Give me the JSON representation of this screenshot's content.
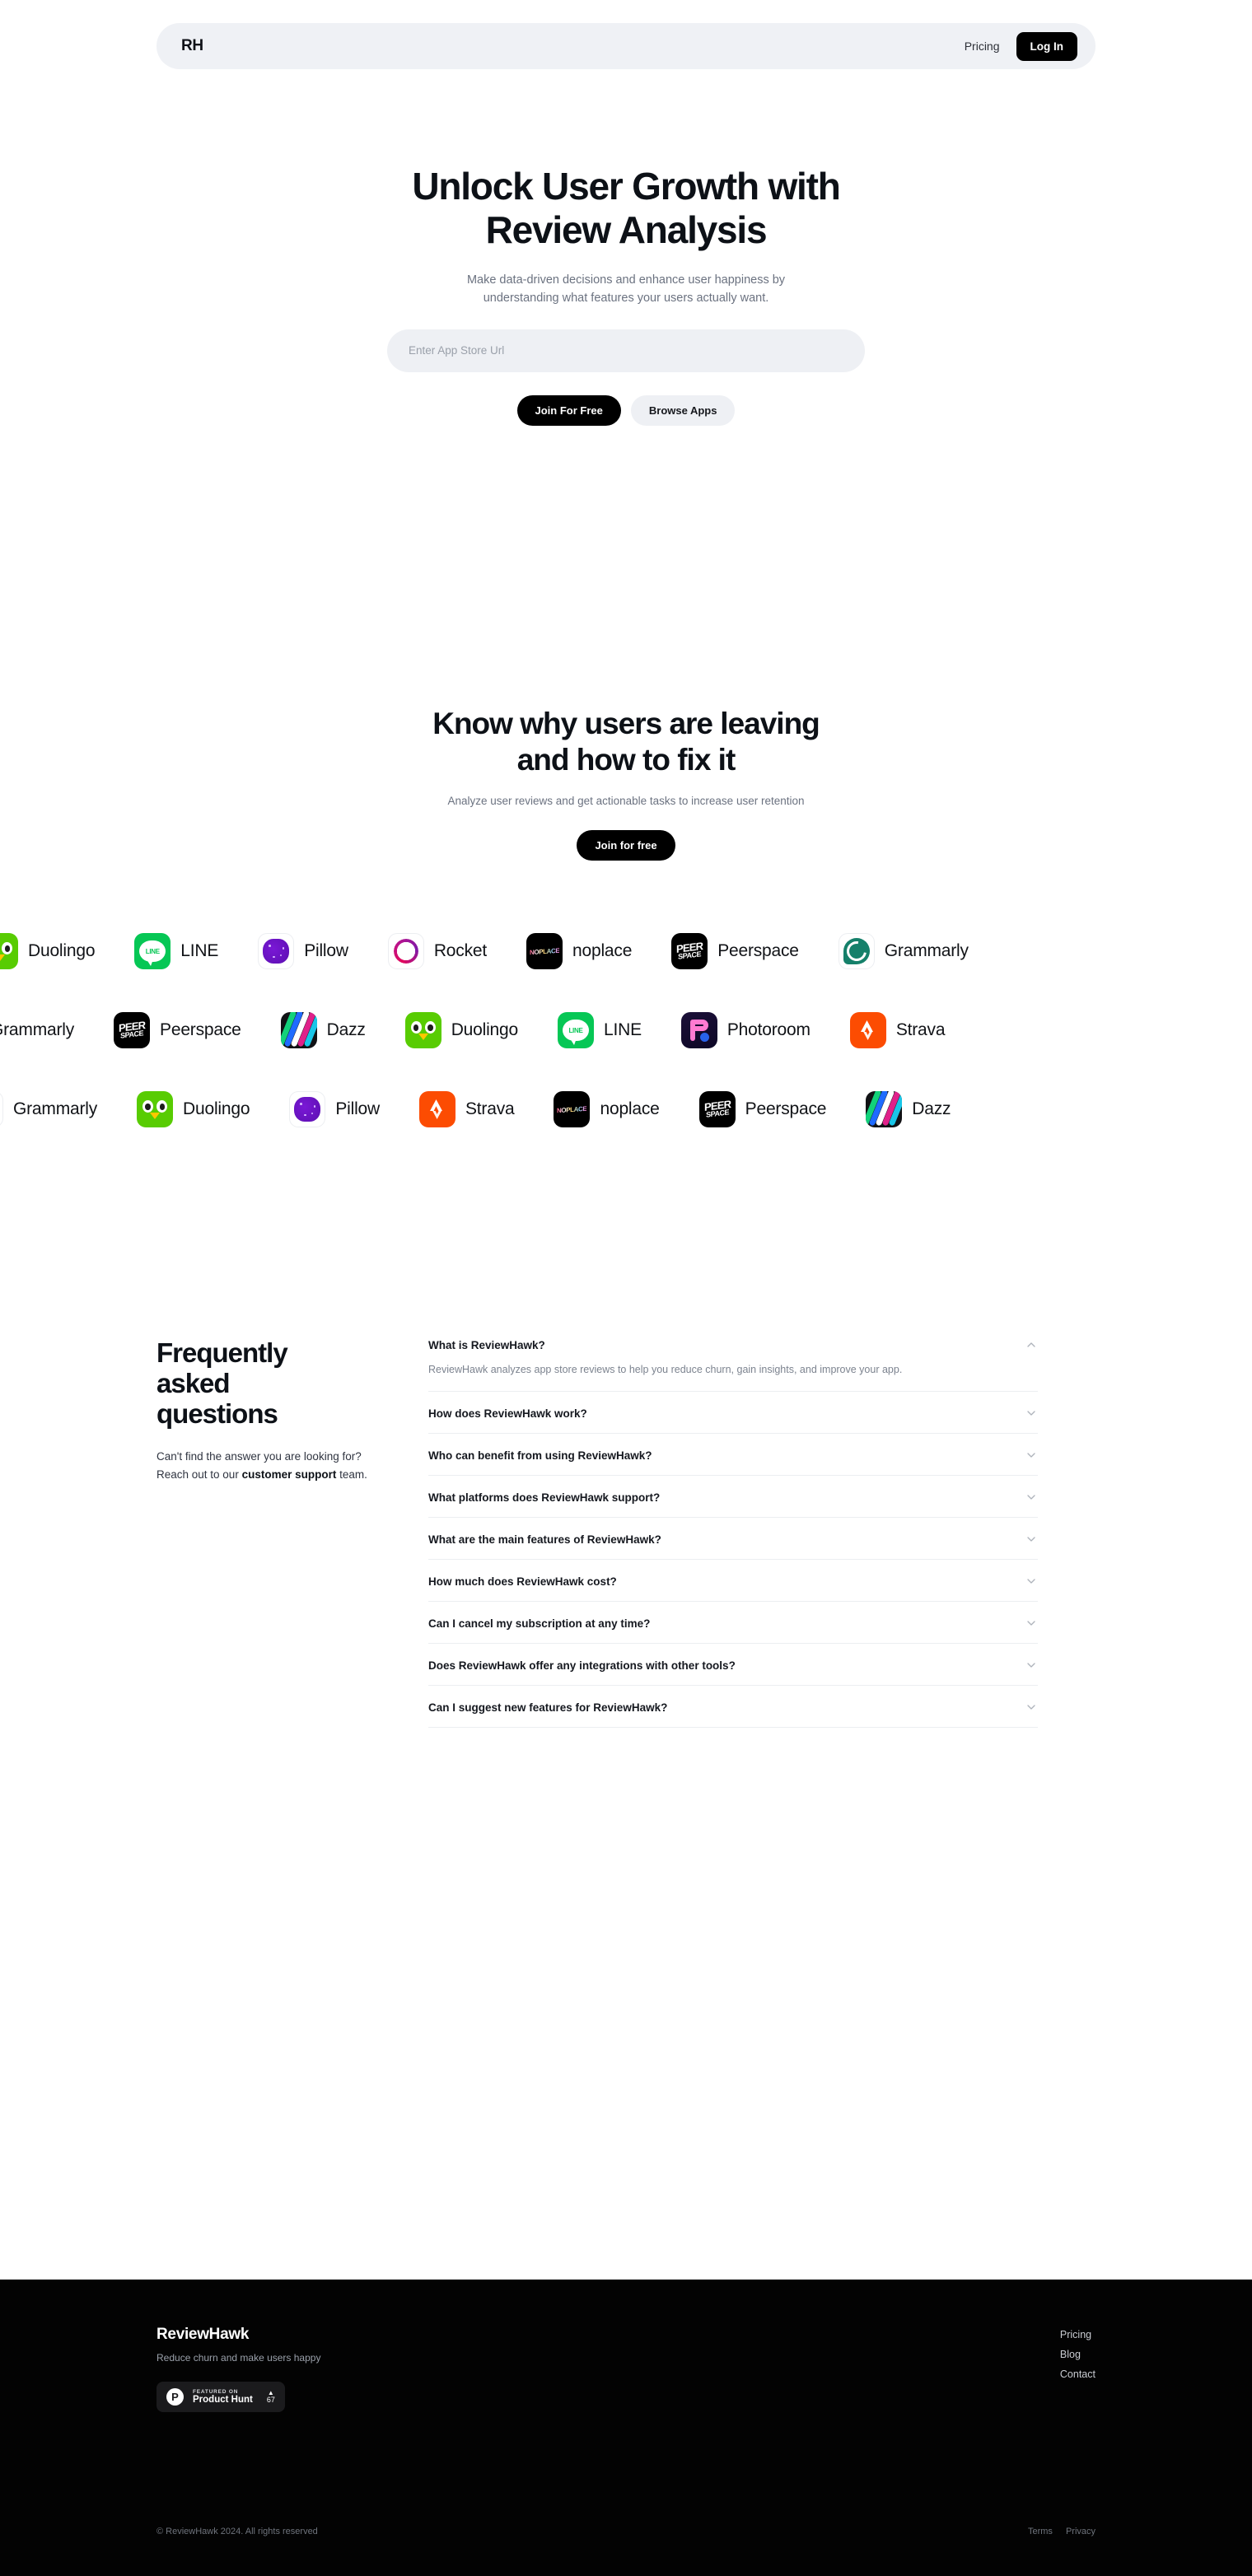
{
  "nav": {
    "logo": "RH",
    "pricing_label": "Pricing",
    "login_label": "Log In"
  },
  "hero": {
    "title_line1": "Unlock User Growth with",
    "title_line2": "Review Analysis",
    "subtitle_line1": "Make data-driven decisions and enhance user happiness by",
    "subtitle_line2": "understanding what features your users actually want.",
    "input_placeholder": "Enter App Store Url",
    "input_value": "",
    "primary_cta": "Join For Free",
    "secondary_cta": "Browse Apps"
  },
  "section2": {
    "title_line1": "Know why users are leaving",
    "title_line2": "and how to fix it",
    "subtitle": "Analyze user reviews and get actionable tasks to increase user retention",
    "cta": "Join for free"
  },
  "marquee": {
    "row1": [
      {
        "name": "Duolingo",
        "icon": "duolingo-icon"
      },
      {
        "name": "LINE",
        "icon": "line-icon"
      },
      {
        "name": "Pillow",
        "icon": "pillow-icon"
      },
      {
        "name": "Rocket",
        "icon": "rocket-icon"
      },
      {
        "name": "noplace",
        "icon": "noplace-icon"
      },
      {
        "name": "Peerspace",
        "icon": "peerspace-icon"
      },
      {
        "name": "Grammarly",
        "icon": "grammarly-icon"
      }
    ],
    "row2": [
      {
        "name": "Grammarly",
        "icon": "grammarly-icon"
      },
      {
        "name": "Peerspace",
        "icon": "peerspace-icon"
      },
      {
        "name": "Dazz",
        "icon": "dazz-icon"
      },
      {
        "name": "Duolingo",
        "icon": "duolingo-icon"
      },
      {
        "name": "LINE",
        "icon": "line-icon"
      },
      {
        "name": "Photoroom",
        "icon": "photoroom-icon"
      },
      {
        "name": "Strava",
        "icon": "strava-icon"
      }
    ],
    "row3": [
      {
        "name": "Grammarly",
        "icon": "grammarly-icon"
      },
      {
        "name": "Duolingo",
        "icon": "duolingo-icon"
      },
      {
        "name": "Pillow",
        "icon": "pillow-icon"
      },
      {
        "name": "Strava",
        "icon": "strava-icon"
      },
      {
        "name": "noplace",
        "icon": "noplace-icon"
      },
      {
        "name": "Peerspace",
        "icon": "peerspace-icon"
      },
      {
        "name": "Dazz",
        "icon": "dazz-icon"
      }
    ]
  },
  "faq": {
    "title_line1": "Frequently",
    "title_line2": "asked",
    "title_line3": "questions",
    "help_text_before": "Can't find the answer you are looking for? Reach out to our ",
    "help_text_bold": "customer support",
    "help_text_after": " team.",
    "items": [
      {
        "question": "What is ReviewHawk?",
        "answer": "ReviewHawk analyzes app store reviews to help you reduce churn, gain insights, and improve your app.",
        "expanded": true
      },
      {
        "question": "How does ReviewHawk work?",
        "answer": "",
        "expanded": false
      },
      {
        "question": "Who can benefit from using ReviewHawk?",
        "answer": "",
        "expanded": false
      },
      {
        "question": "What platforms does ReviewHawk support?",
        "answer": "",
        "expanded": false
      },
      {
        "question": "What are the main features of ReviewHawk?",
        "answer": "",
        "expanded": false
      },
      {
        "question": "How much does ReviewHawk cost?",
        "answer": "",
        "expanded": false
      },
      {
        "question": "Can I cancel my subscription at any time?",
        "answer": "",
        "expanded": false
      },
      {
        "question": "Does ReviewHawk offer any integrations with other tools?",
        "answer": "",
        "expanded": false
      },
      {
        "question": "Can I suggest new features for ReviewHawk?",
        "answer": "",
        "expanded": false
      }
    ]
  },
  "footer": {
    "brand": "ReviewHawk",
    "tagline": "Reduce churn and make users happy",
    "product_hunt": {
      "featured_label": "FEATURED ON",
      "name": "Product Hunt",
      "upvotes": "67"
    },
    "links": [
      "Pricing",
      "Blog",
      "Contact"
    ],
    "copyright": "© ReviewHawk 2024. All rights reserved",
    "legal": [
      "Terms",
      "Privacy"
    ]
  },
  "colors": {
    "accent_dark": "#000000",
    "surface_light": "#eef0f4",
    "text_muted": "#6b7280",
    "footer_bg": "#030303"
  }
}
